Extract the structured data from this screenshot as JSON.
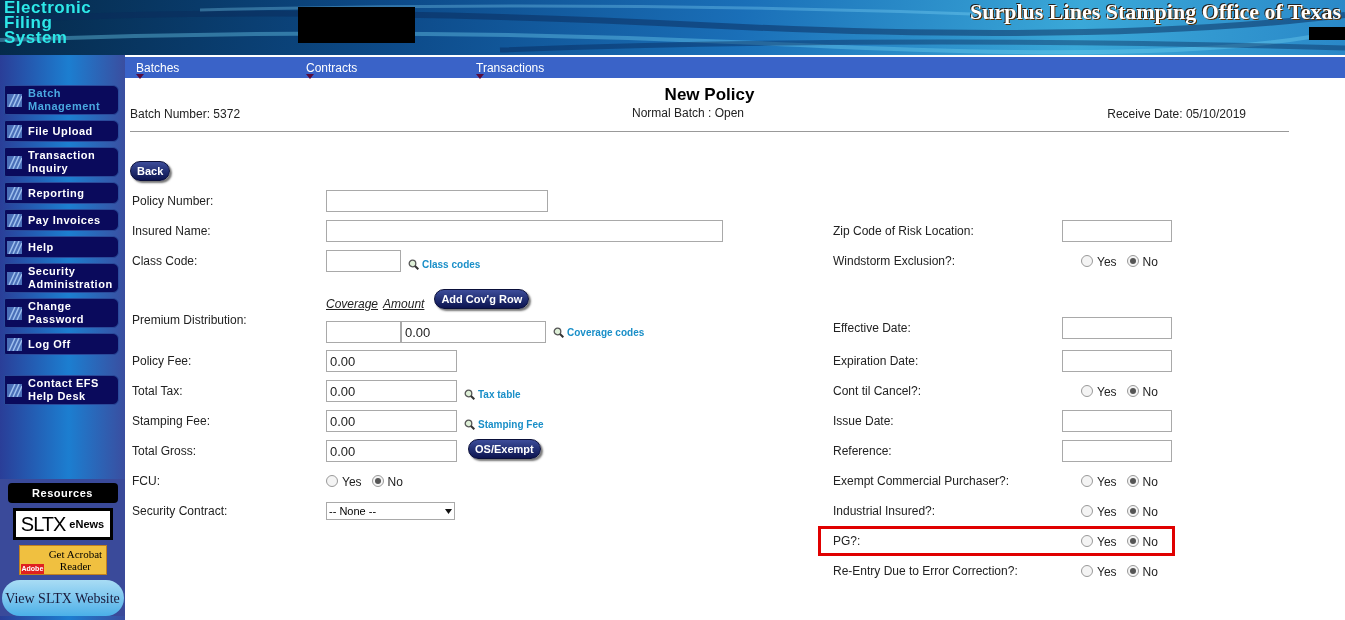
{
  "header": {
    "logo_text": "Electronic Filing System",
    "title": "Surplus Lines Stamping Office of Texas"
  },
  "nav": [
    {
      "label": "Batches"
    },
    {
      "label": "Contracts"
    },
    {
      "label": "Transactions"
    }
  ],
  "sidebar": {
    "items": [
      {
        "label": "Batch Management",
        "selected": true
      },
      {
        "label": "File Upload",
        "selected": false
      },
      {
        "label": "Transaction Inquiry",
        "selected": false
      },
      {
        "label": "Reporting",
        "selected": false
      },
      {
        "label": "Pay Invoices",
        "selected": false
      },
      {
        "label": "Help",
        "selected": false
      },
      {
        "label": "Security Administration",
        "selected": false
      },
      {
        "label": "Change Password",
        "selected": false
      },
      {
        "label": "Log Off",
        "selected": false
      }
    ],
    "contact": "Contact EFS Help Desk",
    "resources": {
      "title": "Resources",
      "enews_logo": "SLTX",
      "enews_label": "eNews",
      "acrobat_brand": "Adobe",
      "acrobat_label": "Get Acrobat Reader",
      "website_button": "View SLTX Website"
    }
  },
  "page": {
    "title": "New Policy",
    "batch_number": "Batch Number: 5372",
    "batch_status": "Normal Batch : Open",
    "receive_date": "Receive Date: 05/10/2019",
    "back_button": "Back"
  },
  "rows": [
    {
      "left": {
        "kind": "text",
        "label": "Policy Number:"
      }
    },
    {
      "left": {
        "kind": "text",
        "label": "Insured Name:"
      },
      "right": {
        "kind": "text",
        "label": "Zip Code of Risk Location:"
      }
    },
    {
      "left": {
        "kind": "text",
        "label": "Class Code:",
        "link": "Class codes"
      },
      "right": {
        "kind": "radio",
        "label": "Windstorm Exclusion?:",
        "options": [
          {
            "label": "Yes",
            "selected": false
          },
          {
            "label": "No",
            "selected": true
          }
        ]
      }
    },
    {
      "left": {
        "kind": "coverage",
        "label": "Premium Distribution:",
        "columns": [
          "Coverage",
          "Amount"
        ],
        "button": "Add Cov'g Row",
        "amount": "0.00",
        "link": "Coverage codes"
      },
      "right": {
        "kind": "text",
        "label": "Effective Date:"
      }
    },
    {
      "left": {
        "kind": "text",
        "label": "Policy Fee:",
        "value": "0.00"
      },
      "right": {
        "kind": "text",
        "label": "Expiration Date:"
      }
    },
    {
      "left": {
        "kind": "text",
        "label": "Total Tax:",
        "value": "0.00",
        "link": "Tax table"
      },
      "right": {
        "kind": "radio",
        "label": "Cont til Cancel?:",
        "options": [
          {
            "label": "Yes",
            "selected": false
          },
          {
            "label": "No",
            "selected": true
          }
        ]
      }
    },
    {
      "left": {
        "kind": "text",
        "label": "Stamping Fee:",
        "value": "0.00",
        "link": "Stamping Fee"
      },
      "right": {
        "kind": "text",
        "label": "Issue Date:"
      }
    },
    {
      "left": {
        "kind": "text",
        "label": "Total Gross:",
        "value": "0.00",
        "button": "OS/Exempt"
      },
      "right": {
        "kind": "text",
        "label": "Reference:"
      }
    },
    {
      "left": {
        "kind": "radio",
        "label": "FCU:",
        "options": [
          {
            "label": "Yes",
            "selected": false
          },
          {
            "label": "No",
            "selected": true
          }
        ]
      },
      "right": {
        "kind": "radio",
        "label": "Exempt Commercial Purchaser?:",
        "options": [
          {
            "label": "Yes",
            "selected": false
          },
          {
            "label": "No",
            "selected": true
          }
        ]
      }
    },
    {
      "left": {
        "kind": "select",
        "label": "Security Contract:",
        "value": "-- None --"
      },
      "right": {
        "kind": "radio",
        "label": "Industrial Insured?:",
        "options": [
          {
            "label": "Yes",
            "selected": false
          },
          {
            "label": "No",
            "selected": true
          }
        ]
      }
    },
    {
      "right": {
        "kind": "radio",
        "label": "PG?:",
        "highlighted": true,
        "options": [
          {
            "label": "Yes",
            "selected": false
          },
          {
            "label": "No",
            "selected": true
          }
        ]
      }
    },
    {
      "right": {
        "kind": "radio",
        "label": "Re-Entry Due to Error Correction?:",
        "highlighted": false,
        "options": [
          {
            "label": "Yes",
            "selected": false
          },
          {
            "label": "No",
            "selected": true
          }
        ]
      }
    }
  ]
}
